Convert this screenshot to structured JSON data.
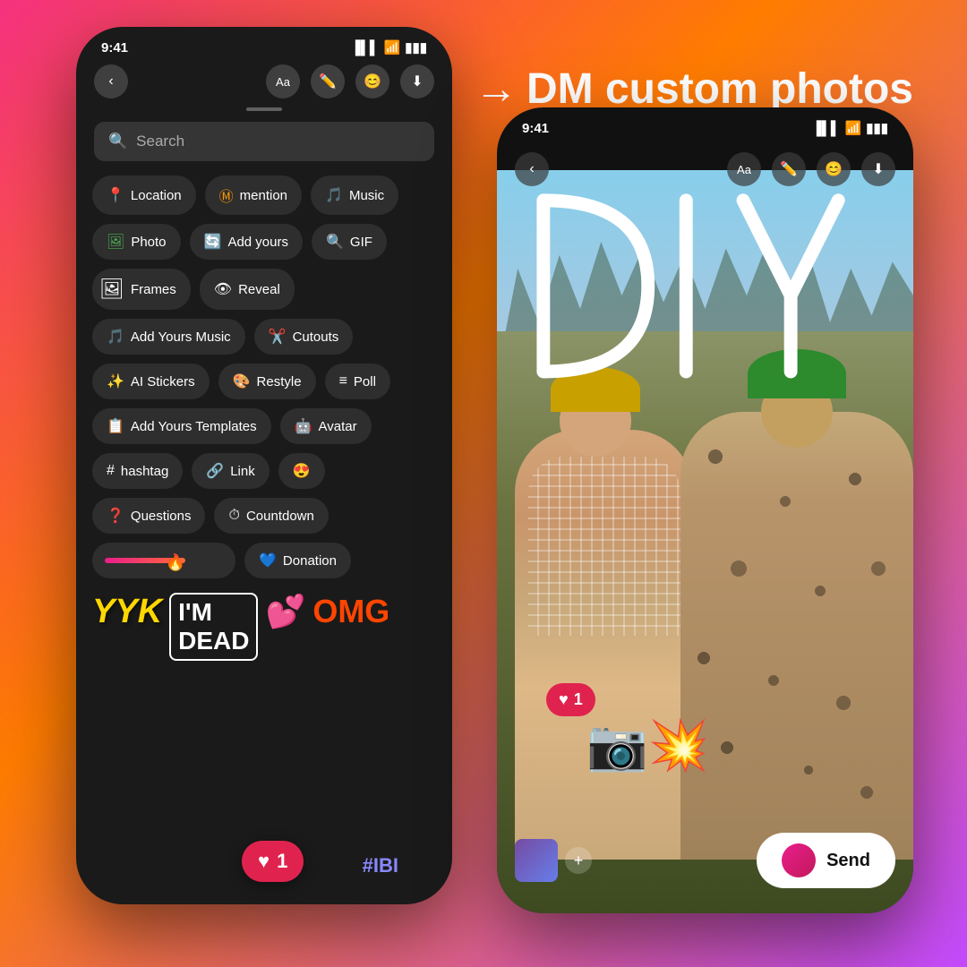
{
  "background": {
    "gradient": "linear-gradient(135deg, #f5317f 0%, #ff7c00 40%, #c44aff 100%)"
  },
  "heading": {
    "arrow": "→",
    "text": "DM custom photos"
  },
  "left_phone": {
    "status_bar": {
      "time": "9:41",
      "signal": "▐▌▌",
      "wifi": "WiFi",
      "battery": "🔋"
    },
    "search": {
      "placeholder": "Search",
      "icon": "🔍"
    },
    "chips": [
      [
        {
          "icon": "📍",
          "label": "Location"
        },
        {
          "icon": "Ⓜ",
          "label": "mention"
        },
        {
          "icon": "🎵",
          "label": "Music"
        }
      ],
      [
        {
          "icon": "🖼",
          "label": "Photo"
        },
        {
          "icon": "🔄",
          "label": "Add yours"
        },
        {
          "icon": "🔍",
          "label": "GIF"
        }
      ],
      [
        {
          "icon": "🖼",
          "label": "Frames"
        },
        {
          "icon": "👁",
          "label": "Reveal"
        }
      ],
      [
        {
          "icon": "🎵",
          "label": "Add Yours Music"
        },
        {
          "icon": "✂",
          "label": "Cutouts"
        }
      ],
      [
        {
          "icon": "✨",
          "label": "AI Stickers"
        },
        {
          "icon": "🎨",
          "label": "Restyle"
        },
        {
          "icon": "≡",
          "label": "Poll"
        }
      ],
      [
        {
          "icon": "📋",
          "label": "Add Yours Templates"
        },
        {
          "icon": "🎭",
          "label": "Avatar"
        }
      ],
      [
        {
          "icon": "#",
          "label": "hashtag"
        },
        {
          "icon": "🔗",
          "label": "Link"
        },
        {
          "icon": "😍",
          "label": ""
        }
      ],
      [
        {
          "icon": "❓",
          "label": "Questions"
        },
        {
          "icon": "⏱",
          "label": "Countdown"
        }
      ],
      [
        {
          "slider": true
        },
        {
          "icon": "💙",
          "label": "Donation"
        }
      ]
    ],
    "heart_badge": {
      "icon": "♥",
      "count": "1"
    },
    "hashtag": "#IBI"
  },
  "right_phone": {
    "status_bar": {
      "time": "9:41",
      "signal": "▐▌▌",
      "wifi": "WiFi",
      "battery": "🔋"
    },
    "drawing_text": "DIY",
    "like_badge": {
      "icon": "♥",
      "count": "1"
    },
    "send_button": {
      "label": "Send"
    },
    "add_label": "+"
  }
}
